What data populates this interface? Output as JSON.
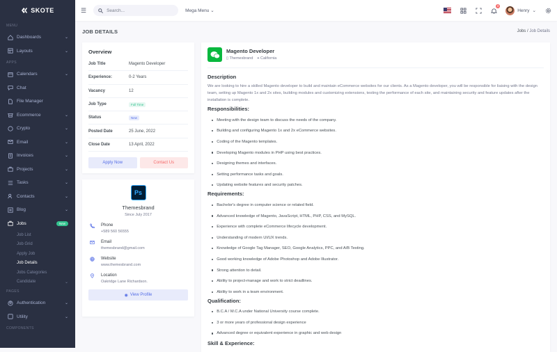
{
  "app": {
    "brand": "SKOTE"
  },
  "sidebar": {
    "menu_title": "MENU",
    "apps_title": "APPS",
    "pages_title": "PAGES",
    "components_title": "COMPONENTS",
    "dashboards": "Dashboards",
    "layouts": "Layouts",
    "apps": [
      "Calendars",
      "Chat",
      "File Manager",
      "Ecommerce",
      "Crypto",
      "Email",
      "Invoices",
      "Projects",
      "Tasks",
      "Contacts",
      "Blog"
    ],
    "jobs": "Jobs",
    "jobs_badge": "New",
    "jobs_sub": [
      "Job List",
      "Job Grid",
      "Apply Job",
      "Job Details",
      "Jobs Categories",
      "Candidate"
    ],
    "pages": [
      "Authentication",
      "Utility"
    ]
  },
  "topbar": {
    "search_placeholder": "Search...",
    "mega_menu": "Mega Menu",
    "notif_count": "3",
    "user_name": "Henry"
  },
  "page": {
    "title": "JOB DETAILS",
    "breadcrumb_parent": "Jobs",
    "breadcrumb_sep": "/",
    "breadcrumb_current": "Job Details"
  },
  "overview": {
    "title": "Overview",
    "rows": [
      {
        "k": "Job Title",
        "v": "Magento Developer"
      },
      {
        "k": "Experience:",
        "v": "0-2 Years"
      },
      {
        "k": "Vacancy",
        "v": "12"
      },
      {
        "k": "Job Type",
        "v": "Full Time"
      },
      {
        "k": "Status",
        "v": "New"
      },
      {
        "k": "Posted Date",
        "v": "25 June, 2022"
      },
      {
        "k": "Close Date",
        "v": "13 April, 2022"
      }
    ],
    "apply": "Apply Now",
    "contact": "Contact Us"
  },
  "company": {
    "logo_text": "Ps",
    "name": "Themesbrand",
    "since": "Since July 2017",
    "phone_label": "Phone",
    "phone": "+589 560 56555",
    "email_label": "Email",
    "email": "themesbrand@gmail.com",
    "website_label": "Website",
    "website": "www.themesbrand.com",
    "location_label": "Location",
    "location": "Oakridge Lane Richardson.",
    "view_profile": "View Profile"
  },
  "job": {
    "title": "Magento Developer",
    "company": "Themesbrand",
    "location": "California",
    "description_title": "Description",
    "description": "We are looking to hire a skilled Magento developer to build and maintain eCommerce websites for our clients. As a Magento developer, you will be responsible for liaising with the design team, setting up Magento 1x and 2x sites, building modules and customizing extensions, testing the performance of each site, and maintaining security and feature updates after the installation is complete.",
    "resp_title": "Responsibilities:",
    "responsibilities": [
      "Meeting with the design team to discuss the needs of the company.",
      "Building and configuring Magento 1x and 2x eCommerce websites.",
      "Coding of the Magento templates.",
      "Developing Magento modules in PHP using best practices.",
      "Designing themes and interfaces.",
      "Setting performance tasks and goals.",
      "Updating website features and security patches."
    ],
    "req_title": "Requirements:",
    "requirements": [
      "Bachelor's degree in computer science or related field.",
      "Advanced knowledge of Magento, JavaScript, HTML, PHP, CSS, and MySQL.",
      "Experience with complete eCommerce lifecycle development.",
      "Understanding of modern UI/UX trends.",
      "Knowledge of Google Tag Manager, SEO, Google Analytics, PPC, and A/B Testing.",
      "Good working knowledge of Adobe Photoshop and Adobe Illustrator.",
      "Strong attention to detail.",
      "Ability to project-manage and work to strict deadlines.",
      "Ability to work in a team environment."
    ],
    "qual_title": "Qualification:",
    "qualifications": [
      "B.C.A / M.C.A under National University course complete.",
      "3 or more years of professional design experience",
      "Advanced degree or equivalent experience in graphic and web design"
    ],
    "skill_title": "Skill & Experience:"
  }
}
